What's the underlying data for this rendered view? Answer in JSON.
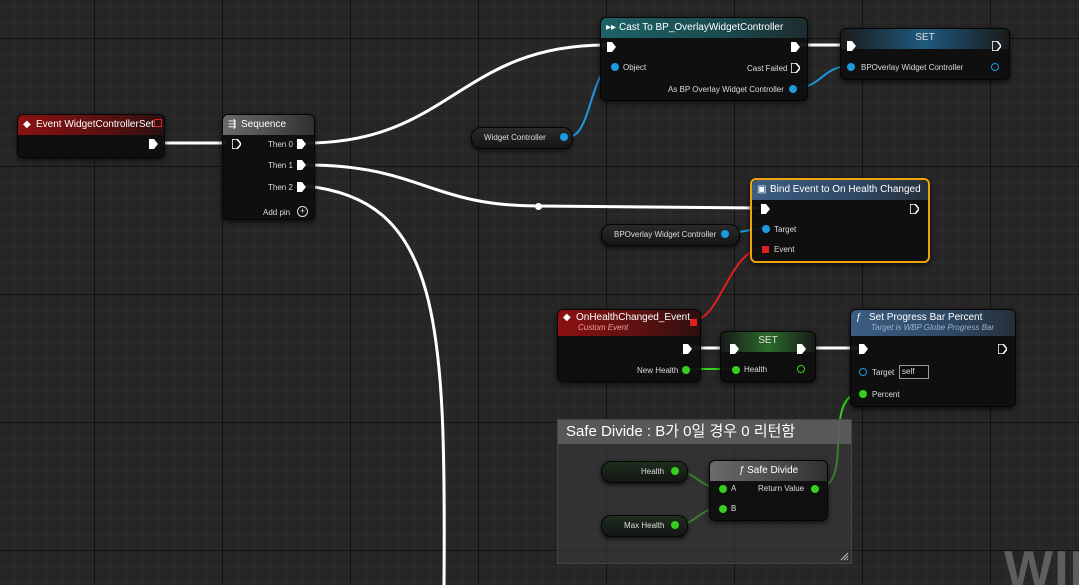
{
  "nodes": {
    "event_widget_controller_set": {
      "title": "Event WidgetControllerSet"
    },
    "sequence": {
      "title": "Sequence",
      "pins": [
        "Then 0",
        "Then 1",
        "Then 2"
      ],
      "add_pin": "Add pin"
    },
    "cast": {
      "title": "Cast To BP_OverlayWidgetController",
      "object": "Object",
      "cast_failed": "Cast Failed",
      "as_output": "As BP Overlay Widget Controller"
    },
    "set_top": {
      "title": "SET",
      "pin": "BPOverlay Widget Controller"
    },
    "bind_event": {
      "title": "Bind Event to On Health Changed",
      "target": "Target",
      "event": "Event"
    },
    "on_health_changed": {
      "title": "OnHealthChanged_Event",
      "subtitle": "Custom Event",
      "new_health": "New Health"
    },
    "set_health": {
      "title": "SET",
      "pin": "Health"
    },
    "set_progress": {
      "title": "Set Progress Bar Percent",
      "subtitle": "Target is WBP Globe Progress Bar",
      "target": "Target",
      "target_value": "self",
      "percent": "Percent"
    },
    "safe_divide": {
      "title": "Safe Divide",
      "a": "A",
      "b": "B",
      "return_value": "Return Value"
    }
  },
  "variables": {
    "widget_controller": "Widget Controller",
    "bp_overlay_widget_controller": "BPOverlay Widget Controller",
    "health": "Health",
    "max_health": "Max Health"
  },
  "comment": {
    "text": "Safe Divide : B가 0일 경우 0 리턴함"
  },
  "watermark": "WII",
  "colors": {
    "exec_wire": "#ffffff",
    "object_pin": "#1e9ae0",
    "float_pin": "#36cf1e",
    "delegate_pin": "#e02020",
    "selected_border": "#f0a20a",
    "event_header": "#8b1111",
    "cast_header": "#1e6266",
    "function_header": "#3c5e82"
  },
  "icons": {
    "event": "diamond-icon",
    "sequence": "sequence-icon",
    "cast": "cast-arrows-icon",
    "bind": "delegate-icon",
    "function": "function-icon",
    "add_pin": "plus-circle-icon"
  }
}
